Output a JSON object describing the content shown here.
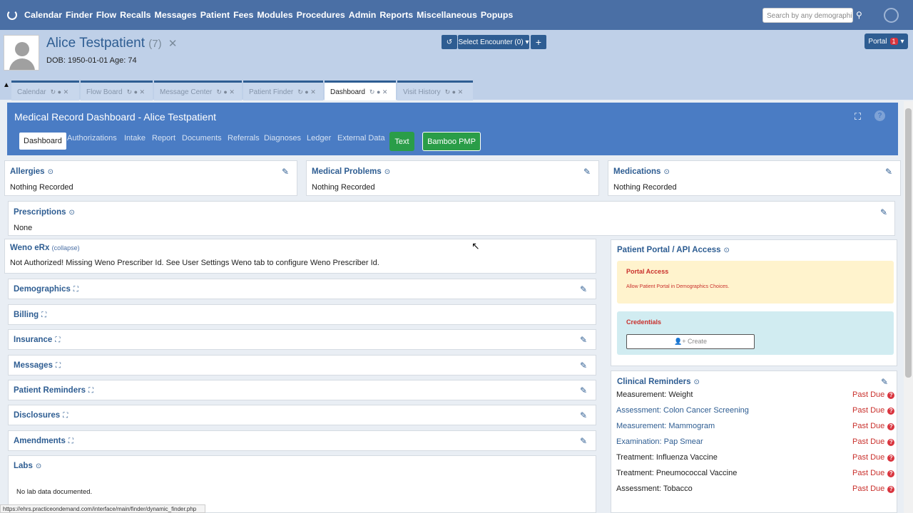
{
  "menu": [
    "Calendar",
    "Finder",
    "Flow",
    "Recalls",
    "Messages",
    "Patient",
    "Fees",
    "Modules",
    "Procedures",
    "Admin",
    "Reports",
    "Miscellaneous",
    "Popups"
  ],
  "search": {
    "placeholder": "Search by any demographics"
  },
  "patient": {
    "name": "Alice Testpatient",
    "id": "(7)",
    "dob": "DOB: 1950-01-01 Age: 74"
  },
  "encounter": {
    "select_label": "Select Encounter (0)"
  },
  "portal": {
    "label": "Portal",
    "badge": "1"
  },
  "tabs": [
    "Calendar",
    "Flow Board",
    "Message Center",
    "Patient Finder",
    "Dashboard",
    "Visit History"
  ],
  "dashboard": {
    "title": "Medical Record Dashboard - Alice Testpatient",
    "nav": [
      "Dashboard",
      "Authorizations",
      "Intake",
      "Report",
      "Documents",
      "Referrals",
      "Diagnoses",
      "Ledger",
      "External Data"
    ],
    "text_btn": "Text",
    "bamboo_btn": "Bamboo PMP"
  },
  "cards": {
    "allergies": {
      "title": "Allergies",
      "text": "Nothing Recorded"
    },
    "problems": {
      "title": "Medical Problems",
      "text": "Nothing Recorded"
    },
    "medications": {
      "title": "Medications",
      "text": "Nothing Recorded"
    },
    "prescriptions": {
      "title": "Prescriptions",
      "text": "None"
    },
    "weno": {
      "title": "Weno eRx",
      "collapse": "(collapse)",
      "text": "Not Authorized! Missing Weno Prescriber Id. See User Settings Weno tab to configure Weno Prescriber Id."
    },
    "demographics": "Demographics",
    "billing": "Billing",
    "insurance": "Insurance",
    "messages": "Messages",
    "reminders": "Patient Reminders",
    "disclosures": "Disclosures",
    "amendments": "Amendments",
    "labs": {
      "title": "Labs",
      "text": "No lab data documented."
    }
  },
  "portal_access": {
    "title": "Patient Portal / API Access",
    "access_title": "Portal Access",
    "access_text": "Allow Patient Portal in Demographics Choices.",
    "credentials": "Credentials",
    "create": "Create"
  },
  "clinical": {
    "title": "Clinical Reminders",
    "due": "Past Due",
    "items": [
      "Measurement: Weight",
      "Assessment: Colon Cancer Screening",
      "Measurement: Mammogram",
      "Examination: Pap Smear",
      "Treatment: Influenza Vaccine",
      "Treatment: Pneumococcal Vaccine",
      "Assessment: Tobacco"
    ]
  },
  "statusbar": "https://ehrs.practiceondemand.com/interface/main/finder/dynamic_finder.php",
  "colors": {
    "topbar": "#4a6fa5",
    "header": "#bfd0e8",
    "dash": "#4a7cc4",
    "green": "#2a9d48",
    "due": "#c9302c",
    "alert_warn": "#fff3cd",
    "alert_info": "#d1ecf1"
  }
}
